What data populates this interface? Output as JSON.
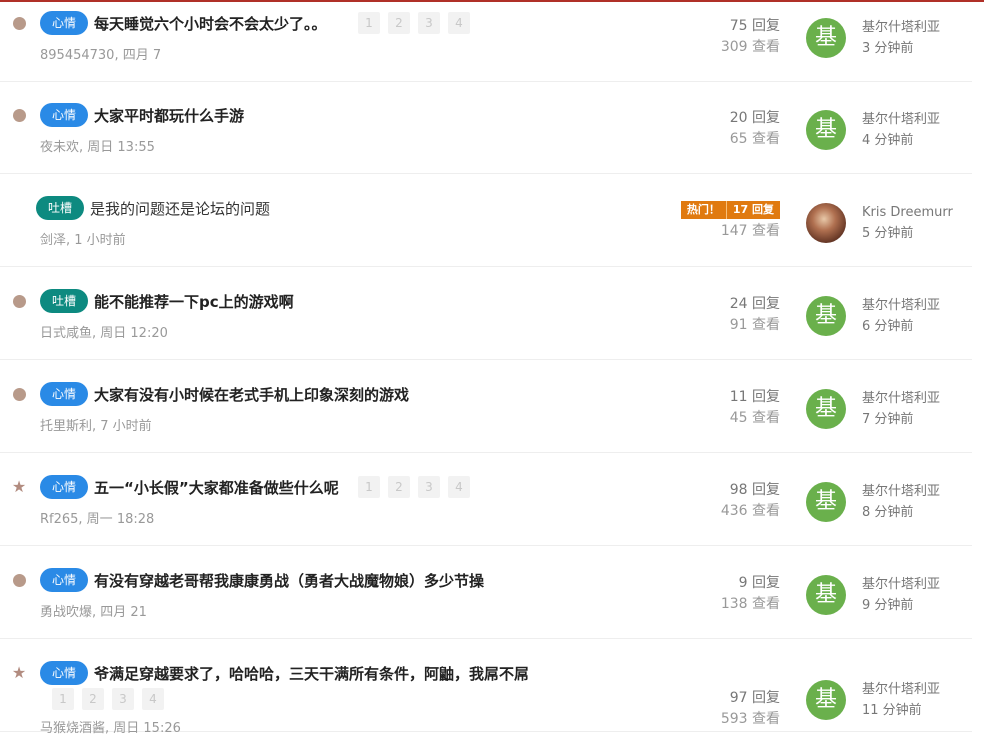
{
  "threads": [
    {
      "state": "dot",
      "tag": "心情",
      "tag_color": "blue",
      "title": "每天睡觉六个小时会不会太少了。。",
      "bold": true,
      "pages": [
        "1",
        "2",
        "3",
        "4"
      ],
      "pages_inline": true,
      "meta": "895454730, 四月 7",
      "replies": "75 回复",
      "views": "309 查看",
      "hot": null,
      "avatar": "基",
      "avatar_photo": false,
      "last_user": "基尔什塔利亚",
      "last_time": "3 分钟前"
    },
    {
      "state": "dot",
      "tag": "心情",
      "tag_color": "blue",
      "title": "大家平时都玩什么手游",
      "bold": true,
      "pages": [],
      "pages_inline": true,
      "meta": "夜未欢, 周日 13:55",
      "replies": "20 回复",
      "views": "65 查看",
      "hot": null,
      "avatar": "基",
      "avatar_photo": false,
      "last_user": "基尔什塔利亚",
      "last_time": "4 分钟前"
    },
    {
      "state": "none",
      "tag": "吐槽",
      "tag_color": "teal",
      "title": "是我的问题还是论坛的问题",
      "bold": false,
      "pages": [],
      "pages_inline": true,
      "meta": "剑泽, 1 小时前",
      "replies": "",
      "views": "147 查看",
      "hot": {
        "label": "热门！",
        "count": "17 回复"
      },
      "avatar": "",
      "avatar_photo": true,
      "last_user": "Kris Dreemurr",
      "last_time": "5 分钟前"
    },
    {
      "state": "dot",
      "tag": "吐槽",
      "tag_color": "teal",
      "title": "能不能推荐一下pc上的游戏啊",
      "bold": true,
      "pages": [],
      "pages_inline": true,
      "meta": "日式咸鱼, 周日 12:20",
      "replies": "24 回复",
      "views": "91 查看",
      "hot": null,
      "avatar": "基",
      "avatar_photo": false,
      "last_user": "基尔什塔利亚",
      "last_time": "6 分钟前"
    },
    {
      "state": "dot",
      "tag": "心情",
      "tag_color": "blue",
      "title": "大家有没有小时候在老式手机上印象深刻的游戏",
      "bold": true,
      "pages": [],
      "pages_inline": true,
      "meta": "托里斯利, 7 小时前",
      "replies": "11 回复",
      "views": "45 查看",
      "hot": null,
      "avatar": "基",
      "avatar_photo": false,
      "last_user": "基尔什塔利亚",
      "last_time": "7 分钟前"
    },
    {
      "state": "star",
      "tag": "心情",
      "tag_color": "blue",
      "title": "五一“小长假”大家都准备做些什么呢",
      "bold": true,
      "pages": [
        "1",
        "2",
        "3",
        "4"
      ],
      "pages_inline": true,
      "meta": "Rf265, 周一 18:28",
      "replies": "98 回复",
      "views": "436 查看",
      "hot": null,
      "avatar": "基",
      "avatar_photo": false,
      "last_user": "基尔什塔利亚",
      "last_time": "8 分钟前"
    },
    {
      "state": "dot",
      "tag": "心情",
      "tag_color": "blue",
      "title": "有没有穿越老哥帮我康康勇战（勇者大战魔物娘）多少节操",
      "bold": true,
      "pages": [],
      "pages_inline": true,
      "meta": "勇战吹爆, 四月 21",
      "replies": "9 回复",
      "views": "138 查看",
      "hot": null,
      "avatar": "基",
      "avatar_photo": false,
      "last_user": "基尔什塔利亚",
      "last_time": "9 分钟前"
    },
    {
      "state": "star",
      "tag": "心情",
      "tag_color": "blue",
      "title": "爷满足穿越要求了，哈哈哈，三天干满所有条件，阿鼬，我屌不屌",
      "bold": true,
      "pages": [
        "1",
        "2",
        "3",
        "4"
      ],
      "pages_inline": false,
      "meta": "马猴烧酒酱, 周日 15:26",
      "replies": "97 回复",
      "views": "593 查看",
      "hot": null,
      "avatar": "基",
      "avatar_photo": false,
      "last_user": "基尔什塔利亚",
      "last_time": "11 分钟前"
    }
  ]
}
